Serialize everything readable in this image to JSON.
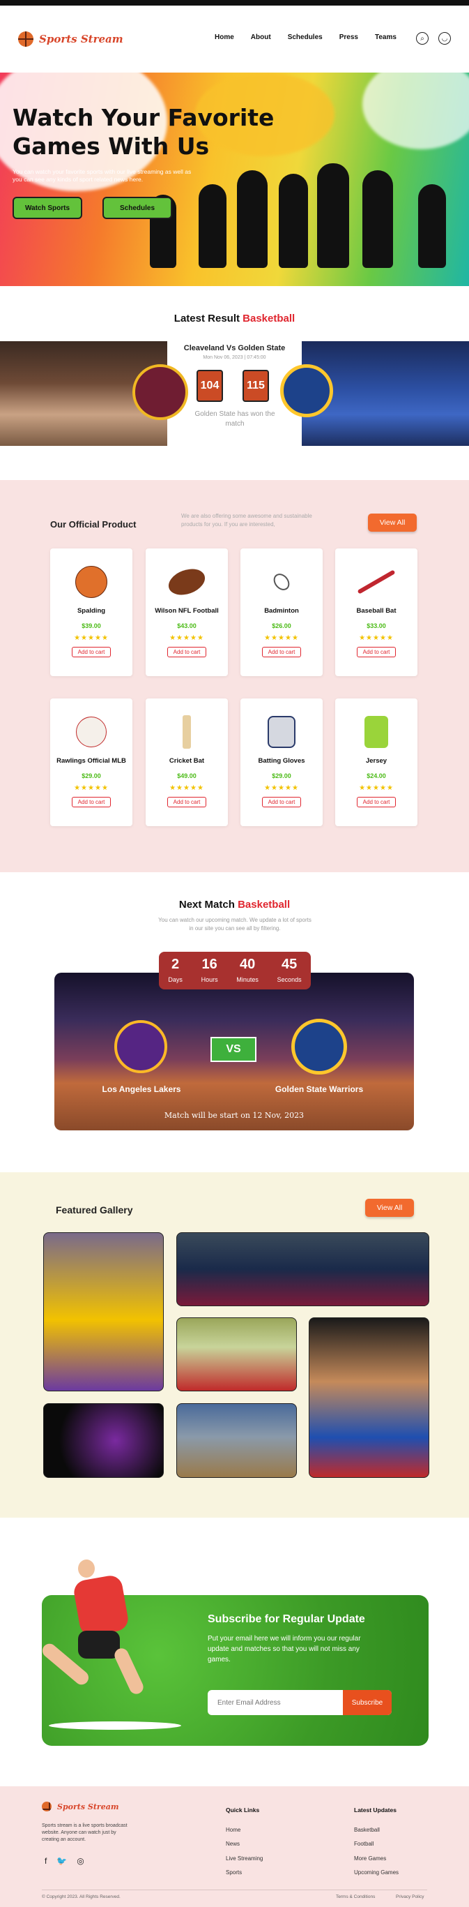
{
  "brand": "Sports Stream",
  "nav": [
    "Home",
    "About",
    "Schedules",
    "Press",
    "Teams"
  ],
  "hero": {
    "title": "Watch Your Favorite Games With Us",
    "text": "You can watch your favorite sports with our live streaming as well as you can see any kinds of sport related news here.",
    "btn1": "Watch Sports",
    "btn2": "Schedules"
  },
  "latest": {
    "t1": "Latest",
    "t2": "Result",
    "t3": "Basketball",
    "match": "Cleaveland Vs Golden State",
    "date": "Mon Nov 06, 2023 | 07:45:00",
    "s1": "104",
    "s2": "115",
    "win": "Golden State has won the match"
  },
  "products": {
    "title": "Our Official Product",
    "desc": "We are also offering some awesome and sustainable products for you. If you are interested,",
    "view": "View All",
    "cart": "Add to cart",
    "stars": "★★★★★",
    "items": [
      {
        "name": "Spalding",
        "price": "$39.00"
      },
      {
        "name": "Wilson NFL Football",
        "price": "$43.00"
      },
      {
        "name": "Badminton",
        "price": "$26.00"
      },
      {
        "name": "Baseball Bat",
        "price": "$33.00"
      },
      {
        "name": "Rawlings Official MLB",
        "price": "$29.00"
      },
      {
        "name": "Cricket Bat",
        "price": "$49.00"
      },
      {
        "name": "Batting Gloves",
        "price": "$29.00"
      },
      {
        "name": "Jersey",
        "price": "$24.00"
      }
    ]
  },
  "next": {
    "t1": "Next Match",
    "t2": "Basketball",
    "desc": "You can watch our upcoming match. We update a lot of sports in our site you can see all by filtering.",
    "d": "2",
    "dl": "Days",
    "h": "16",
    "hl": "Hours",
    "m": "40",
    "ml": "Minutes",
    "s": "45",
    "sl": "Seconds",
    "teamA": "Los Angeles Lakers",
    "teamB": "Golden State Warriors",
    "vs": "VS",
    "start": "Match will be start on 12 Nov, 2023"
  },
  "gallery": {
    "title": "Featured Gallery",
    "view": "View All"
  },
  "subscribe": {
    "title": "Subscribe for Regular Update",
    "text": "Put your email here we will inform you our regular update and matches so that you will not miss any games.",
    "placeholder": "Enter Email Address",
    "btn": "Subscribe"
  },
  "footer": {
    "about": "Sports stream is a live sports broadcast website. Anyone can watch just by creating an account.",
    "ql": "Quick Links",
    "links": [
      "Home",
      "News",
      "Live Streaming",
      "Sports"
    ],
    "lu": "Latest Updates",
    "updates": [
      "Basketball",
      "Football",
      "More Games",
      "Upcoming Games"
    ],
    "copy": "Copyright 2023. All Rights Reserved.",
    "terms": "Terms & Conditions",
    "privacy": "Privacy Policy"
  }
}
